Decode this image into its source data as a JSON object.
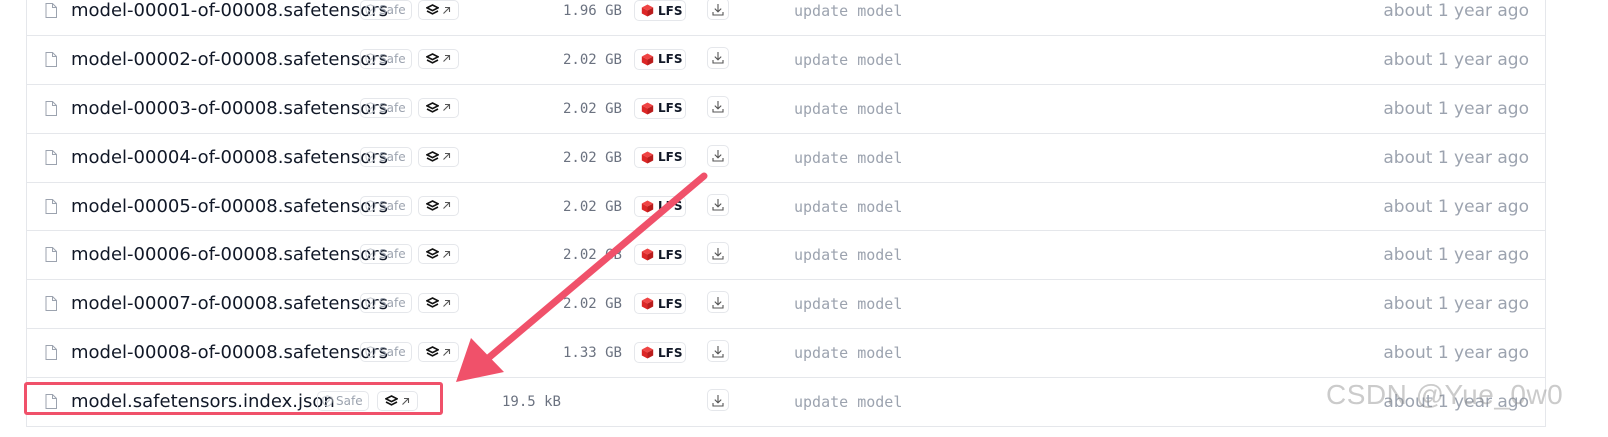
{
  "files": [
    {
      "name": "model-00001-of-00008.safetensors",
      "safe_label": "Safe",
      "size": "1.96 GB",
      "lfs": true,
      "lfs_label": "LFS",
      "commit": "update model",
      "time": "about 1 year ago"
    },
    {
      "name": "model-00002-of-00008.safetensors",
      "safe_label": "Safe",
      "size": "2.02 GB",
      "lfs": true,
      "lfs_label": "LFS",
      "commit": "update model",
      "time": "about 1 year ago"
    },
    {
      "name": "model-00003-of-00008.safetensors",
      "safe_label": "Safe",
      "size": "2.02 GB",
      "lfs": true,
      "lfs_label": "LFS",
      "commit": "update model",
      "time": "about 1 year ago"
    },
    {
      "name": "model-00004-of-00008.safetensors",
      "safe_label": "Safe",
      "size": "2.02 GB",
      "lfs": true,
      "lfs_label": "LFS",
      "commit": "update model",
      "time": "about 1 year ago"
    },
    {
      "name": "model-00005-of-00008.safetensors",
      "safe_label": "Safe",
      "size": "2.02 GB",
      "lfs": true,
      "lfs_label": "LFS",
      "commit": "update model",
      "time": "about 1 year ago"
    },
    {
      "name": "model-00006-of-00008.safetensors",
      "safe_label": "Safe",
      "size": "2.02 GB",
      "lfs": true,
      "lfs_label": "LFS",
      "commit": "update model",
      "time": "about 1 year ago"
    },
    {
      "name": "model-00007-of-00008.safetensors",
      "safe_label": "Safe",
      "size": "2.02 GB",
      "lfs": true,
      "lfs_label": "LFS",
      "commit": "update model",
      "time": "about 1 year ago"
    },
    {
      "name": "model-00008-of-00008.safetensors",
      "safe_label": "Safe",
      "size": "1.33 GB",
      "lfs": true,
      "lfs_label": "LFS",
      "commit": "update model",
      "time": "about 1 year ago"
    },
    {
      "name": "model.safetensors.index.json",
      "safe_label": "Safe",
      "size": "19.5 kB",
      "lfs": false,
      "lfs_label": "",
      "commit": "update model",
      "time": "about 1 year ago"
    }
  ],
  "annotation": {
    "highlighted_file": "model.safetensors.index.json",
    "color": "#f0516a"
  },
  "watermark": "CSDN @Yue_0w0",
  "colors": {
    "lfs_icon": "#e11d48",
    "border": "#e5e7eb",
    "muted_text": "#9ca3af"
  },
  "icons": {
    "file": "file-icon",
    "safe": "shield-check-icon",
    "viewer": "layers-icon",
    "external": "arrow-up-right-icon",
    "lfs": "lfs-cube-icon",
    "download": "download-icon"
  }
}
